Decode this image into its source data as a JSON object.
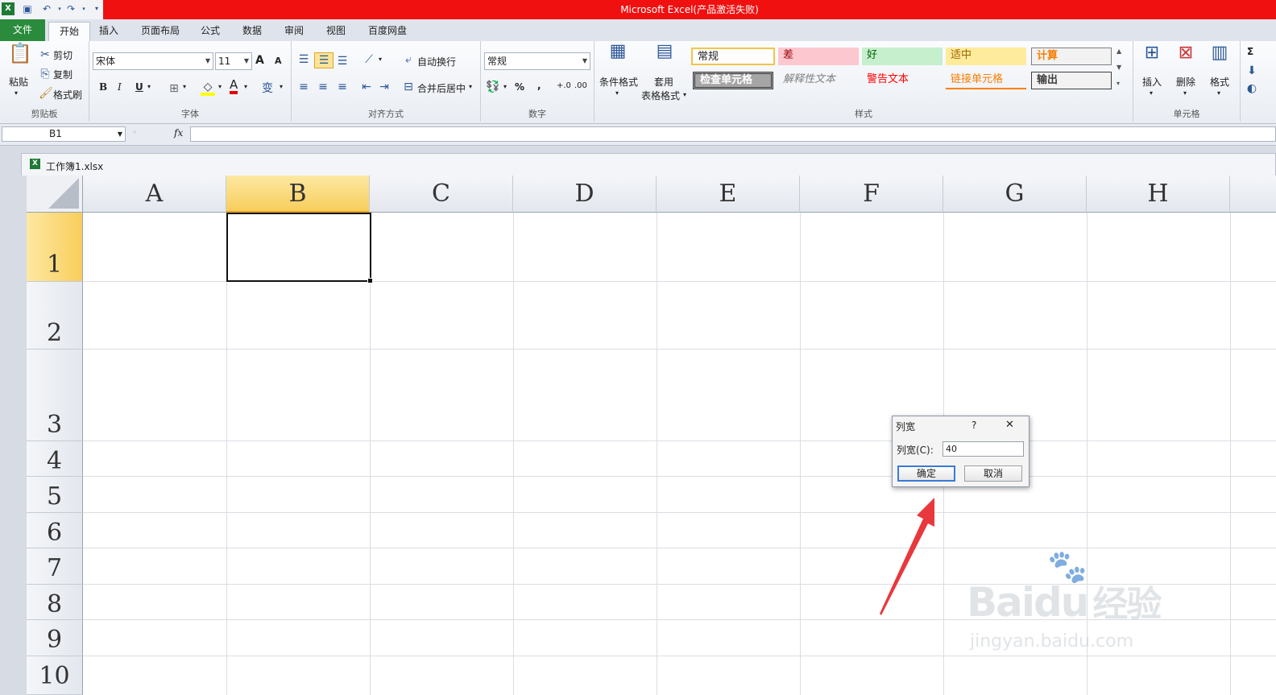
{
  "window": {
    "title": "Microsoft Excel(产品激活失败)"
  },
  "ribbon_tabs": [
    "文件",
    "开始",
    "插入",
    "页面布局",
    "公式",
    "数据",
    "审阅",
    "视图",
    "百度网盘"
  ],
  "clipboard": {
    "paste": "粘贴",
    "cut": "剪切",
    "copy": "复制",
    "format_painter": "格式刷",
    "label": "剪贴板"
  },
  "font": {
    "name": "宋体",
    "size": "11",
    "bold": "B",
    "italic": "I",
    "underline": "U",
    "grow": "A",
    "shrink": "A",
    "color_letter": "A",
    "phonetic": "变",
    "label": "字体"
  },
  "alignment": {
    "wrap_text": "自动换行",
    "merge_center": "合并后居中",
    "label": "对齐方式"
  },
  "number": {
    "format": "常规",
    "percent": "%",
    "comma": ",",
    "inc_decimal": "+.0",
    "dec_decimal": ".00",
    "label": "数字"
  },
  "styles": {
    "conditional_format": "条件格式",
    "table_format_1": "套用",
    "table_format_2": "表格格式",
    "cells": [
      "常规",
      "差",
      "好",
      "适中",
      "计算",
      "检查单元格",
      "解释性文本",
      "警告文本",
      "链接单元格",
      "输出"
    ],
    "label": "样式"
  },
  "cells_group": {
    "insert": "插入",
    "delete": "删除",
    "format": "格式",
    "label": "单元格",
    "sum": "Σ"
  },
  "formula_bar": {
    "name_box": "B1",
    "fx": "fx",
    "value": ""
  },
  "workbook": {
    "title": "工作簿1.xlsx"
  },
  "columns": [
    "A",
    "B",
    "C",
    "D",
    "E",
    "F",
    "G",
    "H"
  ],
  "rows": [
    "1",
    "2",
    "3",
    "4",
    "5",
    "6",
    "7",
    "8",
    "9",
    "10"
  ],
  "dialog": {
    "title": "列宽",
    "help": "?",
    "close": "✕",
    "label": "列宽(C):",
    "value": "40",
    "ok": "确定",
    "cancel": "取消"
  },
  "watermark": {
    "brand_a": "Bai",
    "brand_b": "du",
    "brand_c": "经验",
    "url": "jingyan.baidu.com"
  },
  "colors": {
    "title_bar": "#f01010",
    "file_tab": "#2a8b3c",
    "selection": "#f8ce5c",
    "arrow": "#e8383d"
  }
}
